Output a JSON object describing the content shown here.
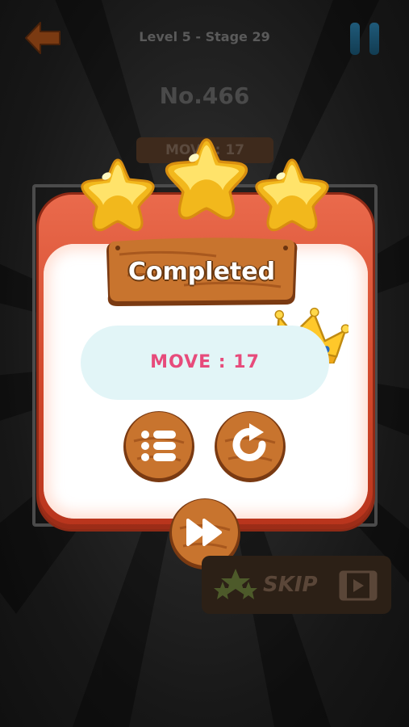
{
  "header": {
    "level_title": "Level 5 -  Stage 29"
  },
  "puzzle": {
    "number": "No.466",
    "moves_label": "MOVE : 17"
  },
  "dialog": {
    "title": "Completed",
    "move_result": "MOVE : 17",
    "stars_earned": 3,
    "stars_total": 3
  },
  "skip": {
    "label": "SKIP"
  },
  "icons": {
    "back": "back-arrow-icon",
    "pause": "pause-icon",
    "menu": "list-icon",
    "replay": "replay-icon",
    "next": "fast-forward-icon",
    "crown": "crown-icon",
    "video": "video-icon"
  },
  "colors": {
    "dialog_red": "#d2492c",
    "wood": "#b8652a",
    "move_text": "#e74b7b",
    "move_pill": "#e2f5f7",
    "star": "#ffd12e"
  }
}
